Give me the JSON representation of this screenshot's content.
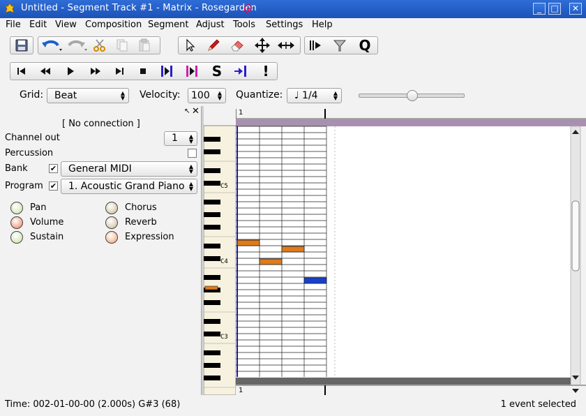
{
  "window": {
    "title": "Untitled - Segment Track #1 - Matrix - Rosegarden",
    "buttons": {
      "minimize": "_",
      "maximize": "□",
      "close": "✕"
    }
  },
  "menu": [
    {
      "label": "File",
      "accel": "F"
    },
    {
      "label": "Edit",
      "accel": "E"
    },
    {
      "label": "View",
      "accel": "V"
    },
    {
      "label": "Composition",
      "accel": "C"
    },
    {
      "label": "Segment",
      "accel": "S"
    },
    {
      "label": "Adjust",
      "accel": "A"
    },
    {
      "label": "Tools",
      "accel": "T"
    },
    {
      "label": "Settings",
      "accel": "S"
    },
    {
      "label": "Help",
      "accel": "H"
    }
  ],
  "transport": {
    "solo_label": "S",
    "panic_label": "!"
  },
  "toolbar": {
    "quantize_label": "Q"
  },
  "controls": {
    "grid_label": "Grid:",
    "grid_value": "Beat",
    "velocity_label": "Velocity:",
    "velocity_value": "100",
    "quantize_label": "Quantize:",
    "quantize_value": "♩ 1/4",
    "slider_value": 0.5
  },
  "instrument": {
    "connection": "[ No connection ]",
    "channel_label": "Channel out",
    "channel_value": "1",
    "percussion_label": "Percussion",
    "percussion_checked": false,
    "bank_label": "Bank",
    "bank_checked": true,
    "bank_value": "General MIDI",
    "program_label": "Program",
    "program_checked": true,
    "program_value": "1. Acoustic Grand Piano",
    "controllers": [
      "Pan",
      "Chorus",
      "Volume",
      "Reverb",
      "Sustain",
      "Expression"
    ]
  },
  "piano": {
    "labels": [
      "C5",
      "C4",
      "C3"
    ]
  },
  "ruler": {
    "bar_top": "1",
    "bar_bottom": "1"
  },
  "notes": [
    {
      "pitch": "E4",
      "start": 0,
      "duration": 1,
      "selected": false
    },
    {
      "pitch": "C#4",
      "start": 1,
      "duration": 1,
      "selected": false
    },
    {
      "pitch": "D#4",
      "start": 2,
      "duration": 1,
      "selected": false
    },
    {
      "pitch": "A#3",
      "start": 3,
      "duration": 1,
      "selected": true
    }
  ],
  "colors": {
    "note": "#e07a1a",
    "note_selected": "#1740d0",
    "segment_bar": "#a98fb0",
    "titlebar": "#2f6dd6"
  },
  "status": {
    "time": "Time: 002-01-00-00 (2.000s)  G#3 (68)",
    "selection": "1 event selected"
  }
}
